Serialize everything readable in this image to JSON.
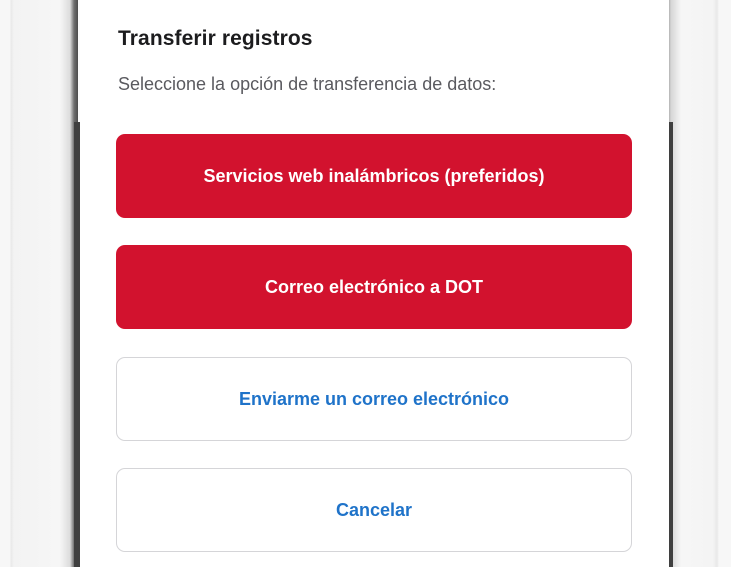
{
  "dialog": {
    "title": "Transferir registros",
    "subtitle": "Seleccione la opción de transferencia de datos:"
  },
  "options": {
    "wireless_label": "Servicios web inalámbricos (preferidos)",
    "email_dot_label": "Correo electrónico a DOT",
    "email_me_label": "Enviarme un correo electrónico",
    "cancel_label": "Cancelar"
  },
  "colors": {
    "primary": "#d2122e",
    "link": "#1f73c9"
  }
}
